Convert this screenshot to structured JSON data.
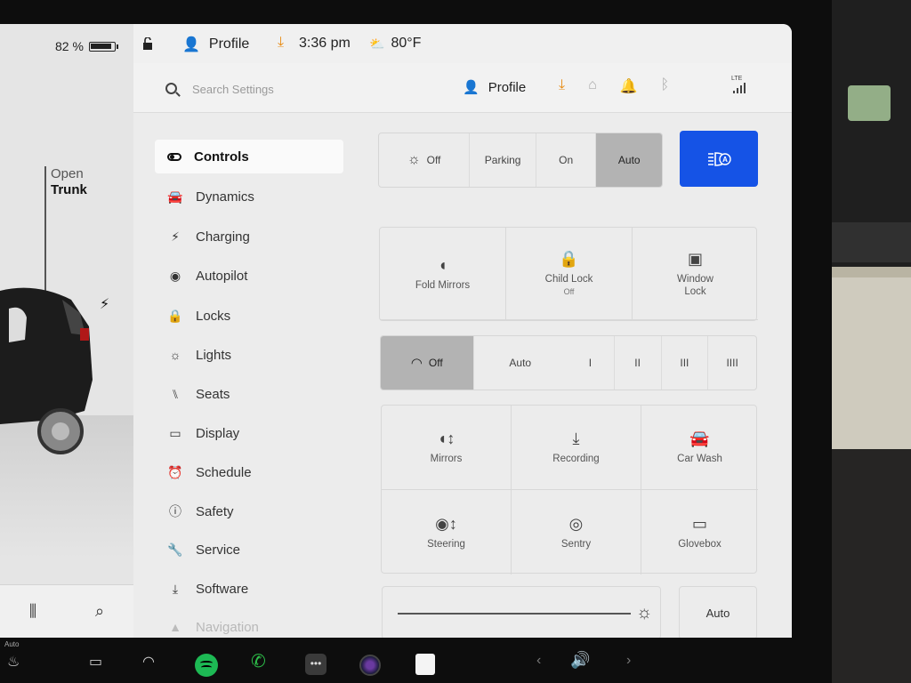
{
  "status_bar": {
    "battery_percent": "82 %",
    "profile": "Profile",
    "time": "3:36 pm",
    "temperature": "80°F"
  },
  "car": {
    "trunk_line1": "Open",
    "trunk_line2": "Trunk"
  },
  "header": {
    "search_placeholder": "Search Settings",
    "profile": "Profile"
  },
  "sidebar": {
    "items": [
      {
        "label": "Controls"
      },
      {
        "label": "Dynamics"
      },
      {
        "label": "Charging"
      },
      {
        "label": "Autopilot"
      },
      {
        "label": "Locks"
      },
      {
        "label": "Lights"
      },
      {
        "label": "Seats"
      },
      {
        "label": "Display"
      },
      {
        "label": "Schedule"
      },
      {
        "label": "Safety"
      },
      {
        "label": "Service"
      },
      {
        "label": "Software"
      },
      {
        "label": "Navigation"
      }
    ]
  },
  "headlights": {
    "options": [
      "Off",
      "Parking",
      "On",
      "Auto"
    ],
    "selected": "Auto"
  },
  "locks_row": {
    "fold_mirrors": "Fold Mirrors",
    "child_lock": "Child Lock",
    "child_lock_state": "Off",
    "window_lock_line1": "Window",
    "window_lock_line2": "Lock"
  },
  "wipers": {
    "options": [
      "Off",
      "Auto",
      "I",
      "II",
      "III",
      "IIII"
    ],
    "selected": "Off"
  },
  "quick_controls": {
    "mirrors": "Mirrors",
    "recording": "Recording",
    "car_wash": "Car Wash",
    "steering": "Steering",
    "sentry": "Sentry",
    "glovebox": "Glovebox"
  },
  "brightness": {
    "level": 1.0,
    "auto_label": "Auto"
  },
  "dock": {
    "seat_heater_label": "Auto"
  }
}
